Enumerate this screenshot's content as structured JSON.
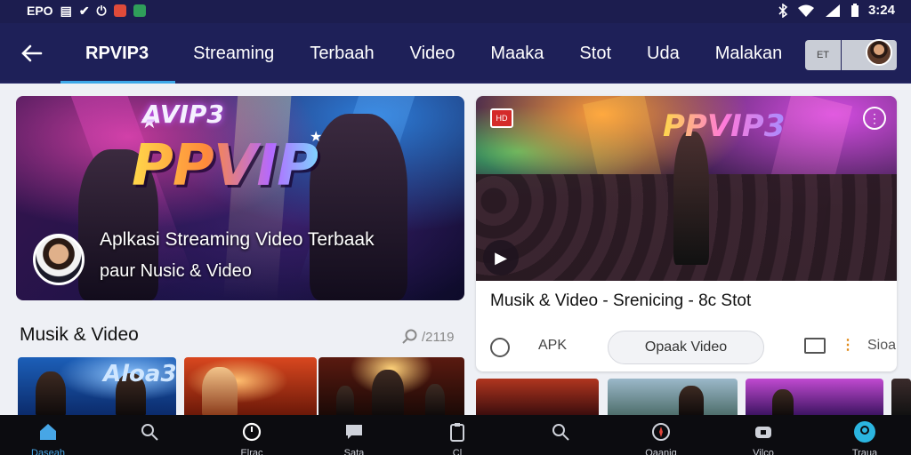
{
  "status_bar": {
    "left_glyphs": [
      "EPO",
      "▤",
      "✔",
      "⏻",
      "◈",
      "◧"
    ],
    "time": "3:24"
  },
  "nav": {
    "tabs": [
      "RPVIP3",
      "Streaming",
      "Terbaah",
      "Video",
      "Maaka",
      "Stot",
      "Uda",
      "Malakan"
    ],
    "active_tab": "RPVIP3",
    "button_label": "ET"
  },
  "hero": {
    "logo_small": "AVIP3",
    "logo": "PPVIP",
    "title": "Aplkasi Streaming Video Terbaak",
    "subtitle": "paur Nusic & Video"
  },
  "card": {
    "logo": "PPVIP3",
    "badge": "HD",
    "title": "Musik & Video - Srenicing - 8c Stot",
    "actions": {
      "apk": "APK",
      "open": "Opaak Video",
      "extra": "Sioa"
    }
  },
  "section": {
    "title": "Musik & Video",
    "search_text": "/2119",
    "thumb1_text": "Aloa3"
  },
  "bottom_nav": {
    "items": [
      {
        "label": "Daseah",
        "icon": "home-icon"
      },
      {
        "label": "",
        "icon": "search-icon"
      },
      {
        "label": "Elrac",
        "icon": "clock-icon"
      },
      {
        "label": "Sata",
        "icon": "chat-icon"
      },
      {
        "label": "Cl",
        "icon": "clipboard-icon"
      },
      {
        "label": "",
        "icon": "search-icon"
      },
      {
        "label": "Oaaniq",
        "icon": "compass-icon"
      },
      {
        "label": "Vilco",
        "icon": "gamepad-icon"
      },
      {
        "label": "Traua",
        "icon": "profile-icon"
      }
    ],
    "active_index": 0,
    "accent": "#47a6e6"
  }
}
